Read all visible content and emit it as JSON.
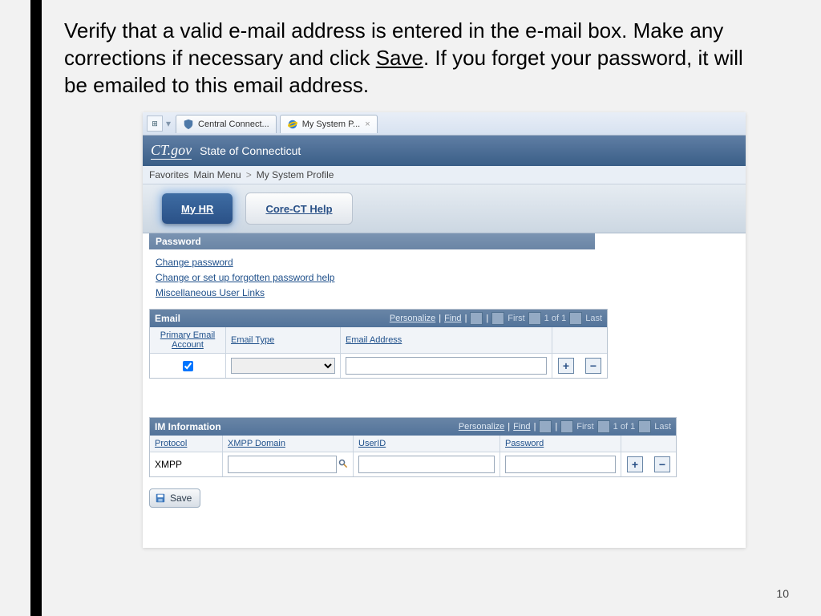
{
  "instruction": {
    "part1": "Verify that a valid e-mail address is entered in the e-mail box.  Make any corrections if necessary and click ",
    "save": "Save",
    "part2": ".  If you forget your password, it will be emailed to this email address."
  },
  "page_number": "10",
  "tabs": {
    "tab1": "Central Connect...",
    "tab2": "My System P..."
  },
  "header": {
    "logo": "CT.gov",
    "title": "State of Connecticut"
  },
  "breadcrumb": {
    "favorites": "Favorites",
    "main_menu": "Main Menu",
    "sep": ">",
    "current": "My System Profile"
  },
  "nav": {
    "my_hr": "My HR",
    "help": "Core-CT Help"
  },
  "password_section": {
    "title": "Password",
    "link_change": "Change password",
    "link_forgot": "Change or set up forgotten password help",
    "link_misc": "Miscellaneous User Links"
  },
  "email_grid": {
    "title": "Email",
    "tools": {
      "personalize": "Personalize",
      "find": "Find",
      "first": "First",
      "page": "1 of 1",
      "last": "Last"
    },
    "cols": {
      "primary": "Primary Email Account",
      "type": "Email Type",
      "addr": "Email Address"
    },
    "row": {
      "primary_checked": true,
      "type": "",
      "addr": ""
    }
  },
  "im_grid": {
    "title": "IM Information",
    "tools": {
      "personalize": "Personalize",
      "find": "Find",
      "first": "First",
      "page": "1 of 1",
      "last": "Last"
    },
    "cols": {
      "protocol": "Protocol",
      "domain": "XMPP Domain",
      "userid": "UserID",
      "password": "Password"
    },
    "row": {
      "protocol": "XMPP",
      "domain": "",
      "userid": "",
      "password": ""
    }
  },
  "save_label": "Save"
}
